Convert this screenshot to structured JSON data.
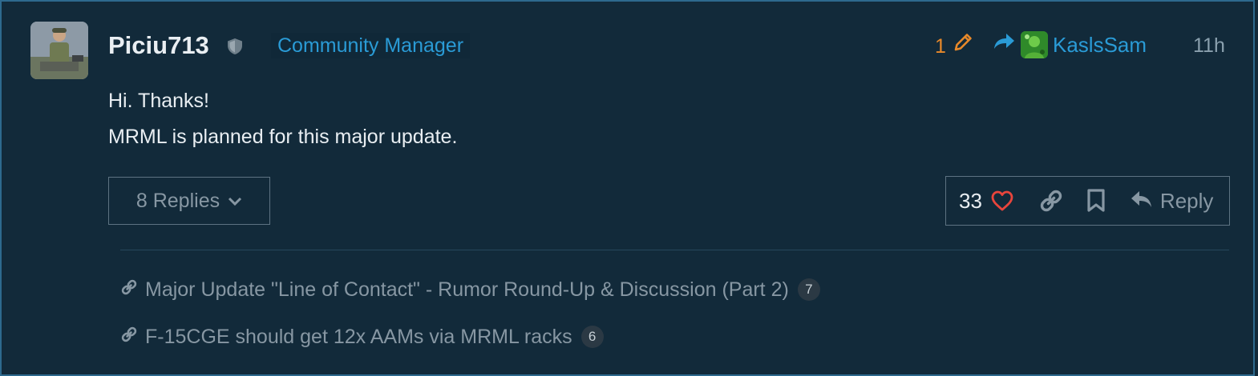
{
  "post": {
    "username": "Piciu713",
    "role": "Community Manager",
    "edit_count": "1",
    "reply_to_user": "KaslsSam",
    "time": "11h",
    "body": [
      "Hi. Thanks!",
      "MRML is planned for this major update."
    ]
  },
  "controls": {
    "replies_label": "8 Replies",
    "like_count": "33",
    "reply_label": "Reply"
  },
  "linked_topics": [
    {
      "title": "Major Update \"Line of Contact\" - Rumor Round-Up & Discussion (Part 2)",
      "count": "7"
    },
    {
      "title": "F-15CGE should get 12x AAMs via MRML racks",
      "count": "6"
    }
  ],
  "colors": {
    "background": "#122a3a",
    "accent_blue": "#2a9bd6",
    "edit_orange": "#e8892a",
    "like_red": "#e8453c"
  },
  "icons": [
    "shield-icon",
    "pencil-icon",
    "share-arrow-icon",
    "chevron-down-icon",
    "heart-icon",
    "link-icon",
    "bookmark-icon",
    "reply-icon"
  ]
}
